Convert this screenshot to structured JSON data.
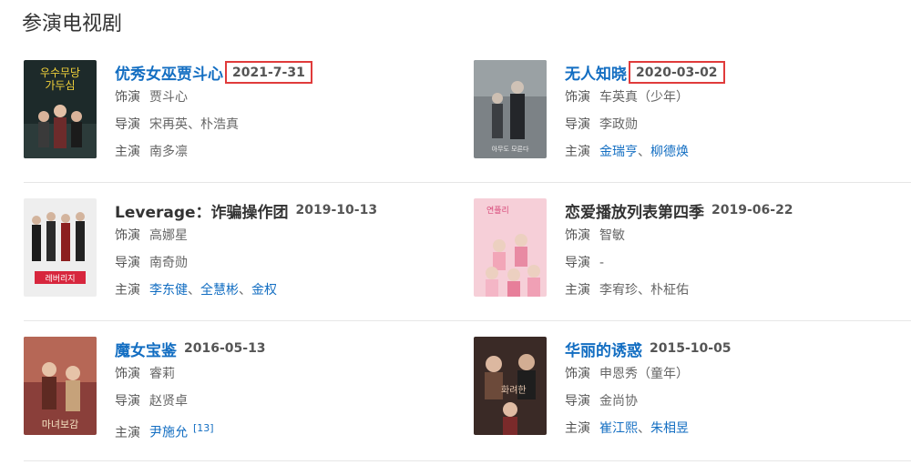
{
  "page_title": "参演电视剧",
  "colors": {
    "link": "#136ec2",
    "highlight_box": "#e03b3b",
    "divider": "#e6e6e6"
  },
  "dramas": [
    {
      "title": "优秀女巫贾斗心",
      "date": "2021-7-31",
      "date_highlighted": true,
      "role_label": "饰演",
      "role": "贾斗心",
      "director_label": "导演",
      "director": "宋再英、朴浩真",
      "lead_label": "主演",
      "leads": [
        "南多凛"
      ],
      "leads_linked": false,
      "poster_icon": "poster-thumbnail"
    },
    {
      "title": "无人知晓",
      "date": "2020-03-02",
      "date_highlighted": true,
      "role_label": "饰演",
      "role": "车英真（少年）",
      "director_label": "导演",
      "director": "李政勋",
      "lead_label": "主演",
      "leads": [
        "金瑞亨",
        "柳德焕"
      ],
      "leads_linked": true,
      "poster_icon": "poster-thumbnail"
    },
    {
      "title": "Leverage：诈骗操作团",
      "date": "2019-10-13",
      "date_highlighted": false,
      "title_linked": false,
      "role_label": "饰演",
      "role": "高娜星",
      "director_label": "导演",
      "director": "南奇勋",
      "lead_label": "主演",
      "leads": [
        "李东健",
        "全慧彬",
        "金权"
      ],
      "leads_linked": true,
      "poster_icon": "poster-thumbnail"
    },
    {
      "title": "恋爱播放列表第四季",
      "date": "2019-06-22",
      "date_highlighted": false,
      "title_linked": false,
      "role_label": "饰演",
      "role": "智敏",
      "director_label": "导演",
      "director": "-",
      "lead_label": "主演",
      "leads": [
        "李宥珍",
        "朴柾佑"
      ],
      "leads_linked": false,
      "poster_icon": "poster-thumbnail"
    },
    {
      "title": "魔女宝鉴",
      "date": "2016-05-13",
      "date_highlighted": false,
      "role_label": "饰演",
      "role": "睿莉",
      "director_label": "导演",
      "director": "赵贤卓",
      "lead_label": "主演",
      "leads": [
        "尹施允"
      ],
      "leads_linked": true,
      "footnote": "[13]",
      "poster_icon": "poster-thumbnail"
    },
    {
      "title": "华丽的诱惑",
      "date": "2015-10-05",
      "date_highlighted": false,
      "role_label": "饰演",
      "role": "申恩秀（童年）",
      "director_label": "导演",
      "director": "金尚协",
      "lead_label": "主演",
      "leads": [
        "崔江熙",
        "朱相昱"
      ],
      "leads_linked": true,
      "poster_icon": "poster-thumbnail"
    }
  ]
}
